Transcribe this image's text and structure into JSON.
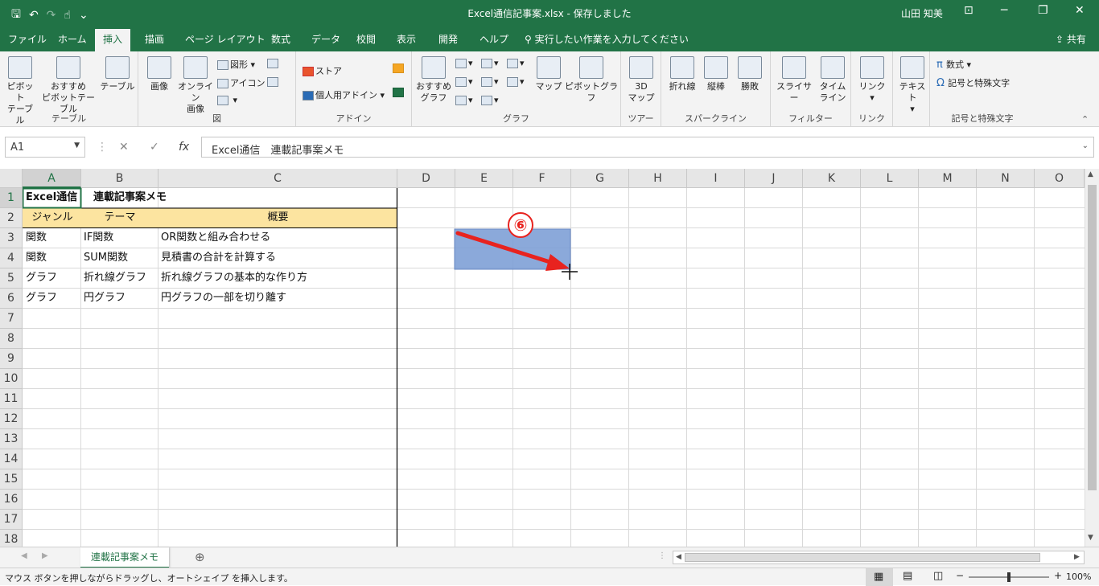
{
  "window": {
    "title": "Excel通信記事案.xlsx  -  保存しました",
    "user": "山田 知美",
    "min": "─",
    "max": "❐",
    "close": "✕",
    "layout": "⊡"
  },
  "qat": {
    "save": "🖫",
    "undo": "↶",
    "redo": "↷",
    "touch": "☝",
    "more": "⌄"
  },
  "tabs": [
    "ファイル",
    "ホーム",
    "挿入",
    "描画",
    "ページ レイアウト",
    "数式",
    "データ",
    "校閲",
    "表示",
    "開発",
    "ヘルプ"
  ],
  "active_tab": "挿入",
  "tellme": "実行したい作業を入力してください",
  "share": "共有",
  "ribbon": {
    "groups": [
      "テーブル",
      "図",
      "アドイン",
      "グラフ",
      "ツアー",
      "スパークライン",
      "フィルター",
      "リンク",
      "記号と特殊文字"
    ],
    "buttons": {
      "pivot": "ピボット\nテーブル",
      "rec_pivot": "おすすめ\nピボットテーブル",
      "table": "テーブル",
      "picture": "画像",
      "online_pic": "オンライン\n画像",
      "shapes": "図形",
      "icons": "アイコン",
      "store": "ストア",
      "my_addins": "個人用アドイン",
      "rec_charts": "おすすめ\nグラフ",
      "map": "マップ",
      "pivot_chart": "ピボットグラフ",
      "map3d": "3D\nマップ",
      "line": "折れ線",
      "column": "縦棒",
      "winloss": "勝敗",
      "slicer": "スライサー",
      "timeline": "タイム\nライン",
      "link": "リンク",
      "text": "テキスト",
      "equation": "数式",
      "symbol": "記号と特殊文字"
    }
  },
  "formula": {
    "namebox": "A1",
    "cancel": "✕",
    "enter": "✓",
    "fx": "fx",
    "content": "Excel通信　連載記事案メモ"
  },
  "columns": [
    "A",
    "B",
    "C",
    "D",
    "E",
    "F",
    "G",
    "H",
    "I",
    "J",
    "K",
    "L",
    "M",
    "N",
    "O"
  ],
  "rows": [
    "1",
    "2",
    "3",
    "4",
    "5",
    "6",
    "7",
    "8",
    "9",
    "10",
    "11",
    "12",
    "13",
    "14",
    "15",
    "16",
    "17",
    "18"
  ],
  "cells": {
    "A1": "Excel通信",
    "B1": "連載記事案メモ",
    "A2": "ジャンル",
    "B2": "テーマ",
    "C2": "概要",
    "A3": "関数",
    "B3": "IF関数",
    "C3": "OR関数と組み合わせる",
    "A4": "関数",
    "B4": "SUM関数",
    "C4": "見積書の合計を計算する",
    "A5": "グラフ",
    "B5": "折れ線グラフ",
    "C5": "折れ線グラフの基本的な作り方",
    "A6": "グラフ",
    "B6": "円グラフ",
    "C6": "円グラフの一部を切り離す"
  },
  "annotation": {
    "step": "⑥"
  },
  "sheet": {
    "tab": "連載記事案メモ",
    "add": "⊕"
  },
  "status": {
    "message": "マウス ボタンを押しながらドラッグし、オートシェイプ を挿入します。",
    "zoom": "100%",
    "zoom_level": 1.0
  }
}
